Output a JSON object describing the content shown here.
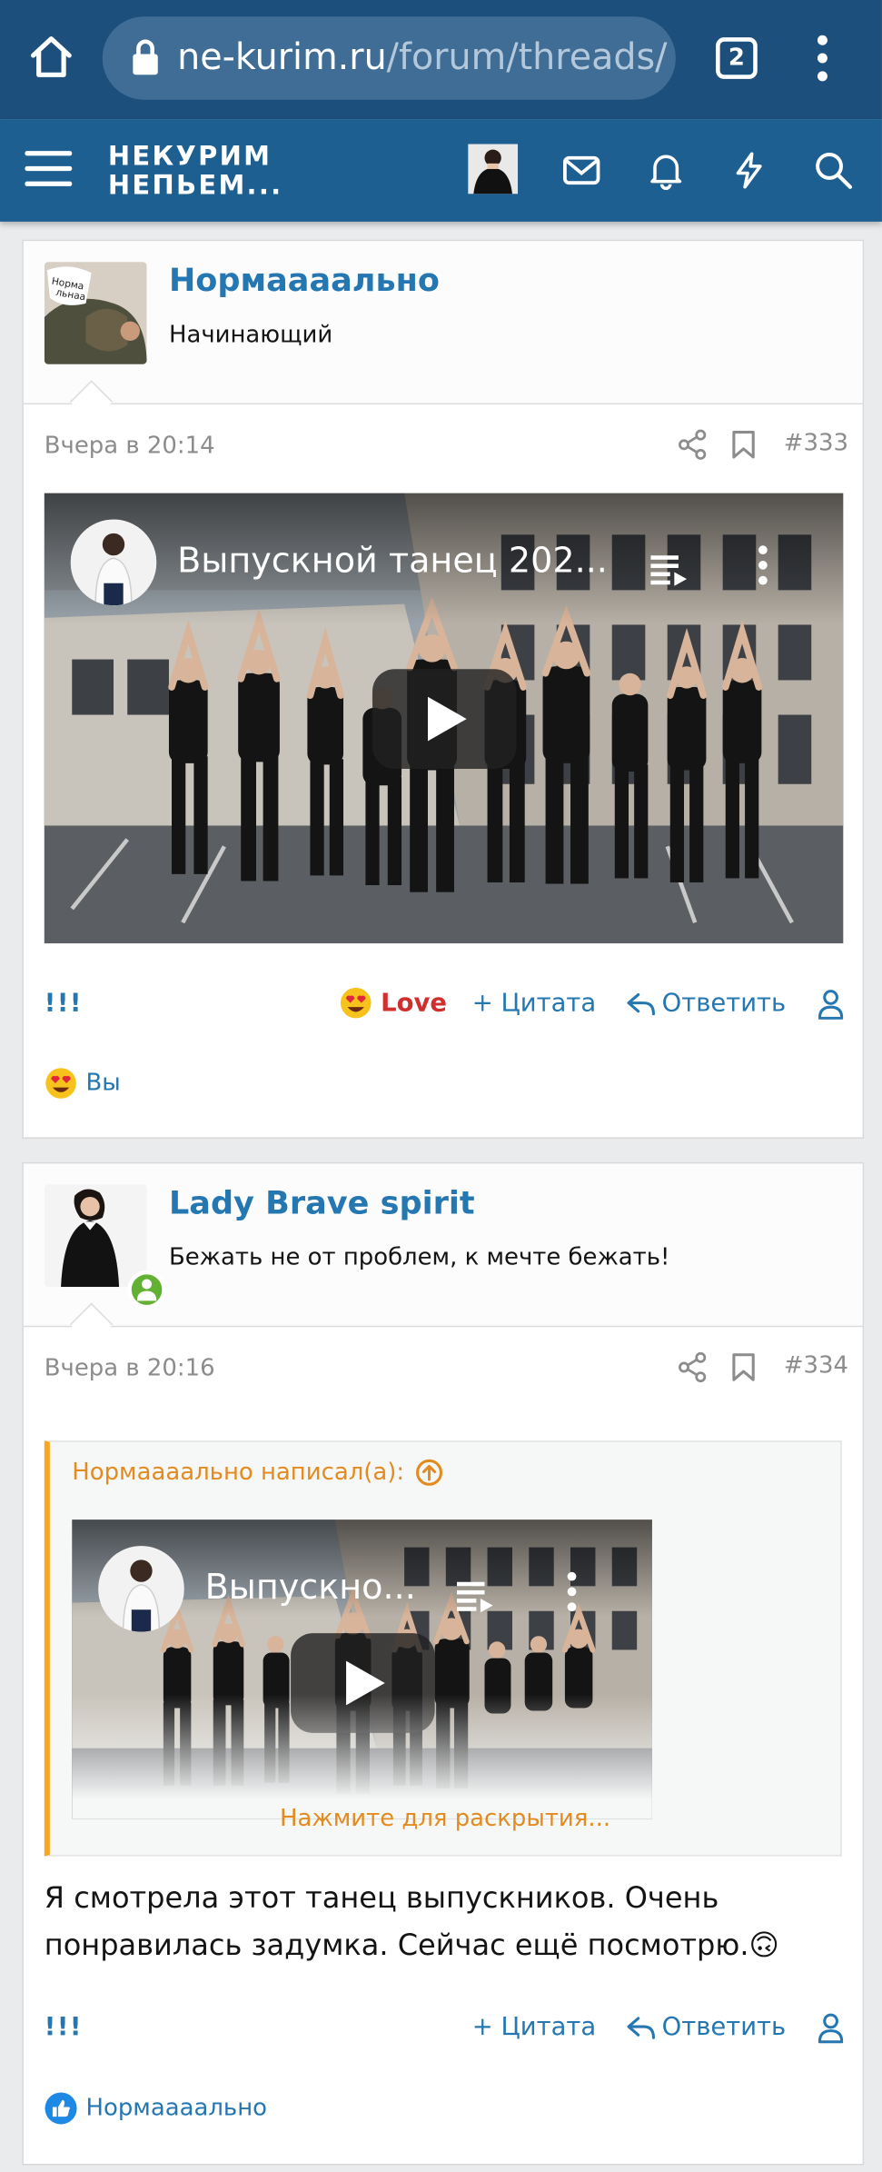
{
  "browser": {
    "url_host": "ne-kurim.ru",
    "url_path": "/forum/threads/",
    "tab_count": "2"
  },
  "forum": {
    "logo_line1": "НЕКУРИМ",
    "logo_line2": "НЕПЬЕМ..."
  },
  "posts": [
    {
      "username": "Нормаааально",
      "user_title": "Начинающий",
      "date": "Вчера в 20:14",
      "number": "#333",
      "video_title": "Выпускной танец 202...",
      "actions": {
        "bang": "!!!",
        "love": "Love",
        "quote": "+ Цитата",
        "reply": "Ответить"
      },
      "reaction_user": "Вы"
    },
    {
      "username": "Lady Brave spirit",
      "user_title": "Бежать не от проблем, к мечте бежать!",
      "date": "Вчера в 20:16",
      "number": "#334",
      "quote_author": "Нормаааально написал(а):",
      "quote_video_title": "Выпускно...",
      "expand_text": "Нажмите для раскрытия...",
      "message": "Я смотрела этот танец выпускников. Очень понравилась задумка. Сейчас ещё посмотрю.🙃",
      "actions": {
        "bang": "!!!",
        "quote": "+ Цитата",
        "reply": "Ответить"
      },
      "reaction_user": "Нормаааально"
    }
  ],
  "colors": {
    "browser_bar": "#1d4f7c",
    "forum_bar": "#1e5f92",
    "link": "#2577b1",
    "love": "#d12e2e",
    "quote_accent": "#f5a623"
  }
}
